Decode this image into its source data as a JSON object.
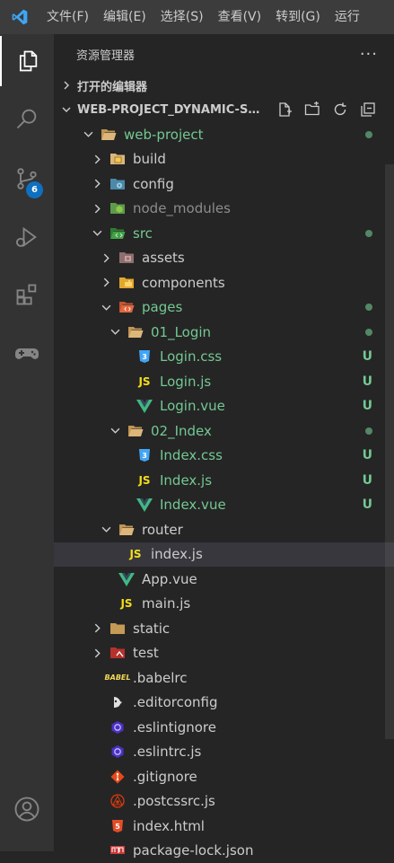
{
  "menubar": {
    "items": [
      "文件(F)",
      "编辑(E)",
      "选择(S)",
      "查看(V)",
      "转到(G)",
      "运行"
    ]
  },
  "activity": {
    "scm_badge": "6"
  },
  "explorer": {
    "title": "资源管理器",
    "more": "···",
    "open_editors": "打开的编辑器",
    "project": "WEB-PROJECT_DYNAMIC-SUB..."
  },
  "tree": [
    {
      "label": "web-project",
      "depth": 0,
      "kind": "folder-open",
      "expanded": true,
      "status": "dot",
      "color": "#73c991"
    },
    {
      "label": "build",
      "depth": 1,
      "kind": "folder-build",
      "expanded": false,
      "color": "#cccccc"
    },
    {
      "label": "config",
      "depth": 1,
      "kind": "folder-config",
      "expanded": false,
      "color": "#cccccc"
    },
    {
      "label": "node_modules",
      "depth": 1,
      "kind": "folder-node",
      "expanded": false,
      "color": "#8c8c8c"
    },
    {
      "label": "src",
      "depth": 1,
      "kind": "folder-src",
      "expanded": true,
      "status": "dot",
      "color": "#73c991"
    },
    {
      "label": "assets",
      "depth": 2,
      "kind": "folder-assets",
      "expanded": false,
      "color": "#cccccc"
    },
    {
      "label": "components",
      "depth": 2,
      "kind": "folder-components",
      "expanded": false,
      "color": "#cccccc"
    },
    {
      "label": "pages",
      "depth": 2,
      "kind": "folder-pages",
      "expanded": true,
      "status": "dot",
      "color": "#73c991"
    },
    {
      "label": "01_Login",
      "depth": 3,
      "kind": "folder-open",
      "expanded": true,
      "status": "dot",
      "color": "#73c991"
    },
    {
      "label": "Login.css",
      "depth": 4,
      "kind": "css",
      "status": "U",
      "color": "#73c991"
    },
    {
      "label": "Login.js",
      "depth": 4,
      "kind": "js",
      "status": "U",
      "color": "#73c991"
    },
    {
      "label": "Login.vue",
      "depth": 4,
      "kind": "vue",
      "status": "U",
      "color": "#73c991"
    },
    {
      "label": "02_Index",
      "depth": 3,
      "kind": "folder-open",
      "expanded": true,
      "status": "dot",
      "color": "#73c991"
    },
    {
      "label": "Index.css",
      "depth": 4,
      "kind": "css",
      "status": "U",
      "color": "#73c991"
    },
    {
      "label": "Index.js",
      "depth": 4,
      "kind": "js",
      "status": "U",
      "color": "#73c991"
    },
    {
      "label": "Index.vue",
      "depth": 4,
      "kind": "vue",
      "status": "U",
      "color": "#73c991"
    },
    {
      "label": "router",
      "depth": 2,
      "kind": "folder-open",
      "expanded": true,
      "color": "#cccccc"
    },
    {
      "label": "index.js",
      "depth": 3,
      "kind": "js",
      "color": "#cccccc",
      "selected": true
    },
    {
      "label": "App.vue",
      "depth": 2,
      "kind": "vue",
      "color": "#cccccc"
    },
    {
      "label": "main.js",
      "depth": 2,
      "kind": "js",
      "color": "#cccccc"
    },
    {
      "label": "static",
      "depth": 1,
      "kind": "folder-static",
      "expanded": false,
      "color": "#cccccc"
    },
    {
      "label": "test",
      "depth": 1,
      "kind": "folder-test",
      "expanded": false,
      "color": "#cccccc"
    },
    {
      "label": ".babelrc",
      "depth": 1,
      "kind": "babel",
      "color": "#cccccc"
    },
    {
      "label": ".editorconfig",
      "depth": 1,
      "kind": "editorconfig",
      "color": "#cccccc"
    },
    {
      "label": ".eslintignore",
      "depth": 1,
      "kind": "eslint",
      "color": "#cccccc"
    },
    {
      "label": ".eslintrc.js",
      "depth": 1,
      "kind": "eslint",
      "color": "#cccccc"
    },
    {
      "label": ".gitignore",
      "depth": 1,
      "kind": "gitignore",
      "color": "#cccccc"
    },
    {
      "label": ".postcssrc.js",
      "depth": 1,
      "kind": "postcss",
      "color": "#cccccc"
    },
    {
      "label": "index.html",
      "depth": 1,
      "kind": "html",
      "color": "#cccccc"
    },
    {
      "label": "package-lock.json",
      "depth": 1,
      "kind": "npm",
      "color": "#cccccc"
    }
  ],
  "colors": {
    "untracked": "#73c991",
    "accent": "#0e70c0",
    "js": "#f5de19",
    "vue": "#41b883",
    "css": "#42a5f5"
  }
}
